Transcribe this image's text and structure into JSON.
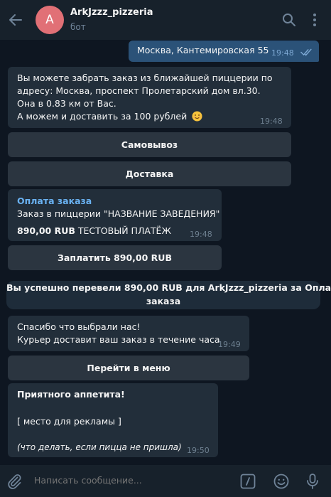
{
  "header": {
    "avatar_letter": "A",
    "avatar_color": "#e17076",
    "title": "ArkJzzz_pizzeria",
    "subtitle": "бот",
    "icons": [
      "back-arrow-icon",
      "search-icon",
      "more-vertical-icon"
    ]
  },
  "messages": {
    "outgoing_address": {
      "text": "Москва, Кантемировская 55",
      "time": "19:48",
      "status": "read"
    },
    "pickup_info": {
      "line1": "Вы можете забрать заказ из ближайшей пиццерии по",
      "line2": "адресу: Москва, проспект Пролетарский дом вл.30.",
      "line3": "Она в 0.83 км от Вас.",
      "line4": "А можем и доставить за 100 рублей",
      "emoji": "smiling-face-emoji",
      "time": "19:48"
    },
    "delivery_buttons": {
      "pickup": "Самовывоз",
      "delivery": "Доставка"
    },
    "invoice": {
      "title": "Оплата заказа",
      "description": "Заказ в пиццерии \"НАЗВАНИЕ ЗАВЕДЕНИЯ\"",
      "amount": "890,00 RUB",
      "test_label": "ТЕСТОВЫЙ ПЛАТЁЖ",
      "time": "19:48",
      "pay_button": "Заплатить 890,00 RUB"
    },
    "service": {
      "line1": "Вы успешно перевели 890,00 RUB для ArkJzzz_pizzeria за Оплата",
      "line2": "заказа"
    },
    "thanks": {
      "line1": "Спасибо что выбрали нас!",
      "line2": "Курьер доставит ваш заказ в течение часа",
      "time": "19:49",
      "menu_button": "Перейти в меню"
    },
    "final": {
      "bold": "Приятного аппетита!",
      "ad": "[ место для рекламы ]",
      "italic": "(что делать, если пицца не пришла)",
      "time": "19:50"
    }
  },
  "composer": {
    "placeholder": "Написать сообщение...",
    "icons": [
      "attach-icon",
      "bot-command-icon",
      "emoji-icon",
      "microphone-icon"
    ]
  },
  "colors": {
    "background": "#0e1621",
    "header": "#17212b",
    "incoming_bubble": "#222e3a",
    "outgoing_bubble": "#2b5278",
    "inline_button": "#2b3540",
    "accent_link": "#6ab2f2"
  }
}
